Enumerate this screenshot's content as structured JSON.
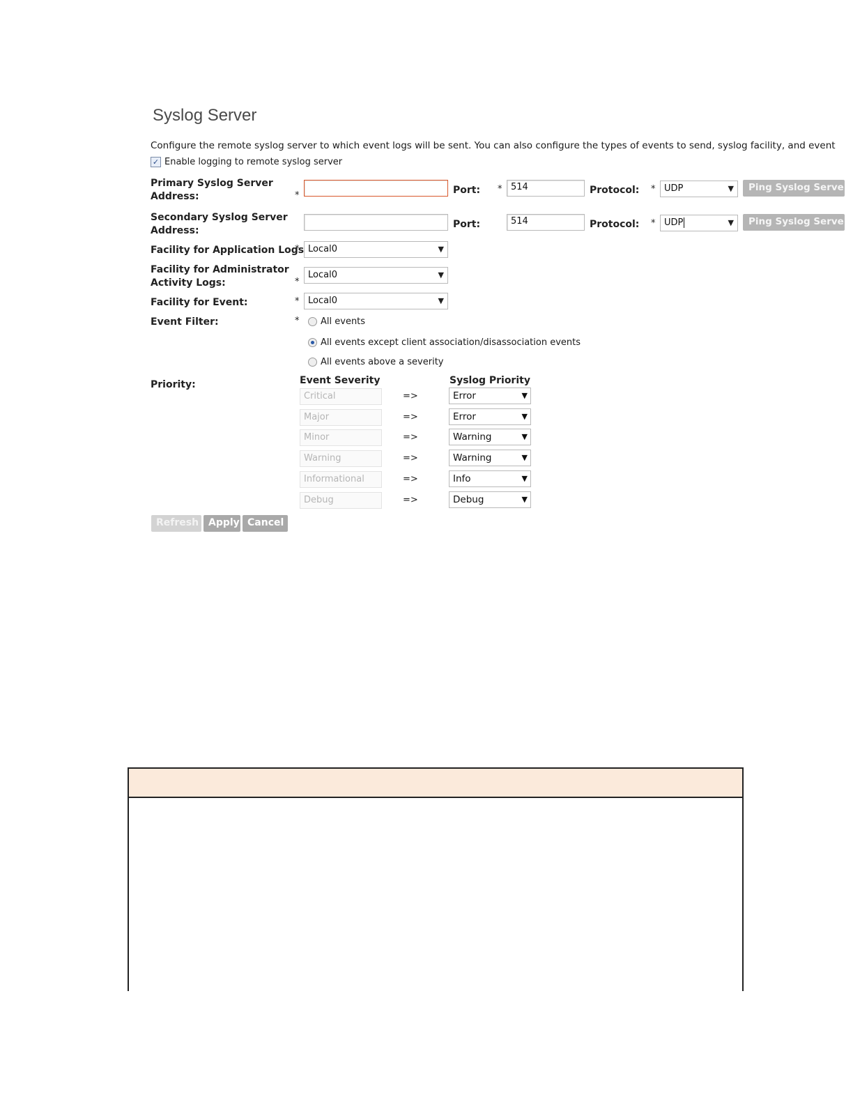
{
  "page": {
    "title": "Syslog Server",
    "description": "Configure the remote syslog server to which event logs will be sent. You can also configure the types of events to send, syslog facility, and event",
    "enable_logging_label": "Enable logging to remote syslog server",
    "enable_logging_checked": true
  },
  "primary": {
    "label_line1": "Primary Syslog Server",
    "label_line2": "Address:",
    "required": "*",
    "address_value": "",
    "port_label": "Port:",
    "port_required": "*",
    "port_value": "514",
    "protocol_label": "Protocol:",
    "protocol_required": "*",
    "protocol_value": "UDP",
    "ping_label": "Ping Syslog Server"
  },
  "secondary": {
    "label_line1": "Secondary Syslog Server",
    "label_line2": "Address:",
    "address_value": "",
    "port_label": "Port:",
    "port_value": "514",
    "protocol_label": "Protocol:",
    "protocol_required": "*",
    "protocol_value": "UDP",
    "ping_label": "Ping Syslog Server"
  },
  "facility_app": {
    "label": "Facility for Application Logs:",
    "required": "*",
    "value": "Local0"
  },
  "facility_admin": {
    "label_line1": "Facility for Administrator",
    "label_line2": "Activity Logs:",
    "required": "*",
    "value": "Local0"
  },
  "facility_event": {
    "label": "Facility for Event:",
    "required": "*",
    "value": "Local0"
  },
  "event_filter": {
    "label": "Event Filter:",
    "required": "*",
    "options": [
      {
        "label": "All events",
        "selected": false
      },
      {
        "label": "All events except client association/disassociation events",
        "selected": true
      },
      {
        "label": "All events above a severity",
        "selected": false
      }
    ]
  },
  "priority": {
    "label": "Priority:",
    "col_severity": "Event Severity",
    "col_syslog": "Syslog Priority",
    "map_symbol": "=>",
    "rows": [
      {
        "severity": "Critical",
        "syslog": "Error"
      },
      {
        "severity": "Major",
        "syslog": "Error"
      },
      {
        "severity": "Minor",
        "syslog": "Warning"
      },
      {
        "severity": "Warning",
        "syslog": "Warning"
      },
      {
        "severity": "Informational",
        "syslog": "Info"
      },
      {
        "severity": "Debug",
        "syslog": "Debug"
      }
    ]
  },
  "buttons": {
    "refresh": "Refresh",
    "apply": "Apply",
    "cancel": "Cancel"
  },
  "colors": {
    "error_border": "#d9572a",
    "button_gray": "#a9a9a9",
    "note_header": "#fbeadb"
  }
}
